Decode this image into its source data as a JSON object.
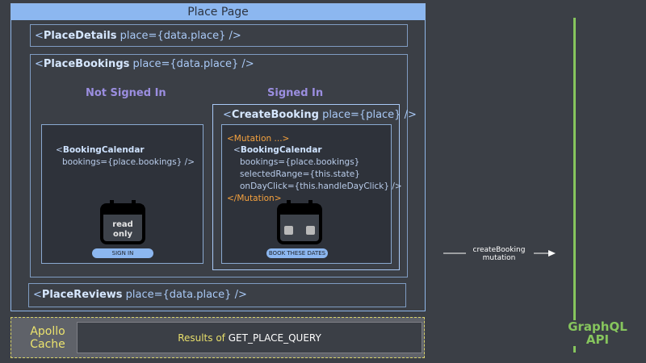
{
  "place_page": {
    "title": "Place Page"
  },
  "place_details": {
    "name": "PlaceDetails",
    "props": "place={data.place} />"
  },
  "place_bookings": {
    "name": "PlaceBookings",
    "props": "place={data.place} />",
    "not_signed_in": {
      "heading": "Not Signed In",
      "calendar_name": "BookingCalendar",
      "calendar_props": "bookings={place.bookings} />",
      "icon_text_line1": "read",
      "icon_text_line2": "only",
      "button_label": "SIGN IN"
    },
    "signed_in": {
      "heading": "Signed In",
      "create_booking_name": "CreateBooking",
      "create_booking_props": "place={place} />",
      "mutation_open": "<Mutation ...>",
      "calendar_name": "BookingCalendar",
      "line_bookings": "bookings={place.bookings}",
      "line_selected": "selectedRange={this.state}",
      "line_ondayclick": "onDayClick={this.handleDayClick} />",
      "mutation_close": "</Mutation>",
      "button_label": "BOOK THESE DATES"
    }
  },
  "place_reviews": {
    "name": "PlaceReviews",
    "props": "place={data.place} />"
  },
  "apollo_cache": {
    "label_line1": "Apollo",
    "label_line2": "Cache",
    "results_prefix": "Results of",
    "results_query": "GET_PLACE_QUERY"
  },
  "arrow": {
    "label_line1": "createBooking",
    "label_line2": "mutation"
  },
  "api": {
    "label_line1": "GraphQL",
    "label_line2": "API"
  },
  "colors": {
    "accent_blue": "#8cb7f0",
    "purple": "#9b8ee0",
    "orange": "#f6a23e",
    "green": "#86c55d",
    "yellow": "#ece36e"
  }
}
